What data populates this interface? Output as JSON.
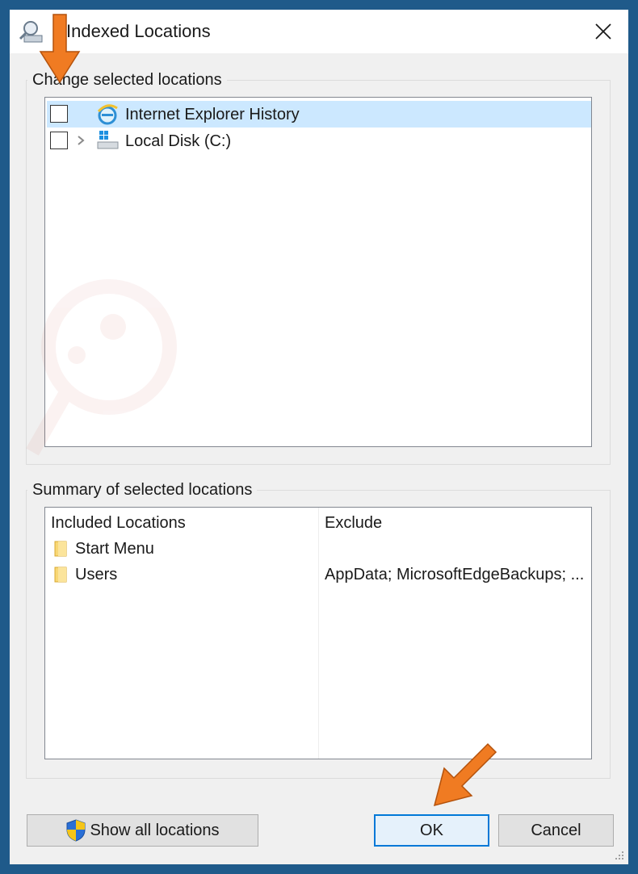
{
  "window": {
    "title": "Indexed Locations",
    "title_icon": "indexed-locations-icon",
    "close_glyph": "✕"
  },
  "change_group": {
    "label": "Change selected locations",
    "items": [
      {
        "label": "Internet Explorer History",
        "checked": false,
        "selected": true,
        "expandable": false,
        "icon": "internet-explorer-icon"
      },
      {
        "label": "Local Disk (C:)",
        "checked": false,
        "selected": false,
        "expandable": true,
        "icon": "local-disk-icon"
      }
    ]
  },
  "summary_group": {
    "label": "Summary of selected locations",
    "columns": [
      "Included Locations",
      "Exclude"
    ],
    "rows": [
      {
        "name": "Start Menu",
        "exclude": ""
      },
      {
        "name": "Users",
        "exclude": "AppData; MicrosoftEdgeBackups; ..."
      }
    ]
  },
  "buttons": {
    "show_all": "Show all locations",
    "ok": "OK",
    "cancel": "Cancel"
  },
  "colors": {
    "selection": "#cce8ff",
    "annotation_arrow": "#f07b22",
    "focus_border": "#0078d7"
  }
}
